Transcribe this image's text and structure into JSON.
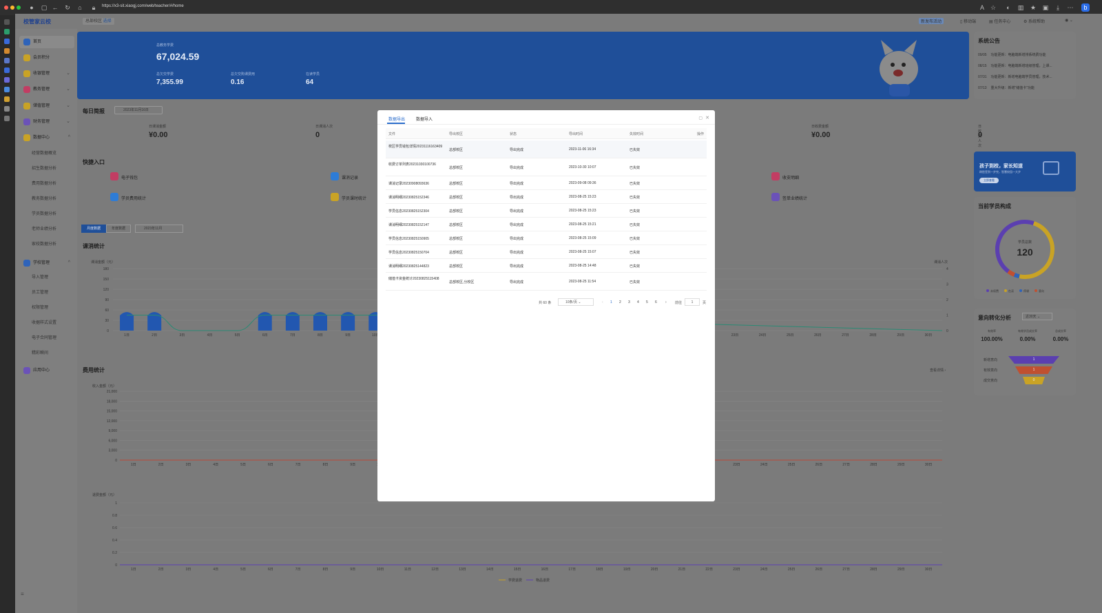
{
  "browser": {
    "url": "https://x3-sit.xiaogj.com/web/teacher/#/home"
  },
  "app": {
    "logo": "校管家云校",
    "campus": "总部校区",
    "campus_switch": "选择"
  },
  "top_right": {
    "badge": "新发布活动",
    "item1": "移动端",
    "item2": "任务中心",
    "item3": "系统帮助"
  },
  "sidebar": {
    "items": [
      {
        "label": "首页",
        "color": "#2e63b9",
        "top": 10
      },
      {
        "label": "会员积分",
        "color": "#c9a325",
        "top": 33
      },
      {
        "label": "收银管理",
        "color": "#c9a325",
        "top": 56,
        "chev": "⌄"
      },
      {
        "label": "教务管理",
        "color": "#c23d63",
        "top": 79,
        "chev": "⌄"
      },
      {
        "label": "储值管理",
        "color": "#c9a325",
        "top": 103,
        "chev": "⌄"
      },
      {
        "label": "财务管理",
        "color": "#6b52b8",
        "top": 126,
        "chev": "⌄"
      },
      {
        "label": "数据中心",
        "color": "#c9a325",
        "top": 149,
        "chev": "^"
      }
    ],
    "data_sub": [
      "经营数据概览",
      "招生数据分析",
      "费用数据分析",
      "教务数据分析",
      "学员数据分析",
      "老师业绩分析",
      "家校数据分析"
    ],
    "school": {
      "label": "学校管理",
      "chev": "^"
    },
    "school_sub": [
      "导入管理",
      "员工管理",
      "权限管理",
      "收据样式设置",
      "电子合同管理",
      "精彩瞬间"
    ],
    "app_center": "应用中心"
  },
  "hero": {
    "total_fee_label": "总教务学费",
    "total_fee": "67,024.59",
    "fee_label": "总欠交学费",
    "fee": "7,355.99",
    "avg_label": "总欠交购课费用",
    "avg": "0.16",
    "students_label": "在读学员",
    "students": "64"
  },
  "notice": {
    "title": "系统公告",
    "rows": [
      {
        "date": "09/05",
        "text": "功能更新：电脑端新增排系统费功能"
      },
      {
        "date": "08/15",
        "text": "功能更新：电脑端新增班级管理，上课..."
      },
      {
        "date": "07/31",
        "text": "功能更新：新增电脑端学员管理，技术..."
      },
      {
        "date": "07/13",
        "text": "重大升级：新增“储值卡”功能"
      }
    ]
  },
  "daily": {
    "title": "每日简报",
    "date": "2023年11月16日",
    "stats": [
      {
        "label": "日课消金额",
        "value": "¥0.00"
      },
      {
        "label": "日课消人次",
        "value": "0"
      },
      {
        "label": "日收费金额",
        "value": "¥0.00"
      },
      {
        "label": "日收费人次",
        "value": "0"
      }
    ]
  },
  "quick": {
    "title": "快捷入口",
    "items": [
      "电子钱包",
      "课消记录",
      "收支明细",
      "学员费用统计",
      "学员课时统计",
      "签单业绩统计"
    ]
  },
  "monthly": {
    "tab1": "月度数据",
    "tab2": "年度数据",
    "month": "2023年11月"
  },
  "course_chart": {
    "title": "课消统计",
    "ylabel": "课消金额（元）",
    "y2label": "课消人次",
    "y_ticks": [
      "180",
      "150",
      "120",
      "90",
      "60",
      "30",
      "0"
    ],
    "y2_ticks": [
      "4",
      "3",
      "2",
      "1",
      "0"
    ]
  },
  "fee_chart": {
    "title": "费用统计",
    "link": "查看详情 ›",
    "ylabel": "收入金额（元）",
    "y_ticks": [
      "21,000",
      "18,000",
      "15,000",
      "12,000",
      "9,000",
      "6,000",
      "3,000",
      "0"
    ]
  },
  "refund_chart": {
    "ylabel": "退费金额（元）",
    "y_ticks": [
      "1",
      "0.8",
      "0.6",
      "0.4",
      "0.2",
      "0"
    ],
    "legend1": "学费退费",
    "legend2": "物品退费"
  },
  "x_days_early": [
    "1日",
    "2日",
    "3日",
    "4日",
    "5日",
    "6日",
    "7日",
    "8日",
    "9日",
    "10日"
  ],
  "x_days_late": [
    "23日",
    "24日",
    "25日",
    "26日",
    "27日",
    "28日",
    "29日",
    "30日"
  ],
  "x_days_all": [
    "1日",
    "2日",
    "3日",
    "4日",
    "5日",
    "6日",
    "7日",
    "8日",
    "9日",
    "10日",
    "11日",
    "12日",
    "13日",
    "14日",
    "15日",
    "16日",
    "17日",
    "18日",
    "19日",
    "20日",
    "21日",
    "22日",
    "23日",
    "24日",
    "25日",
    "26日",
    "27日",
    "28日",
    "29日",
    "30日"
  ],
  "chart_data": {
    "type": "bar",
    "title": "课消统计",
    "categories": [
      "1日",
      "2日",
      "3日",
      "4日",
      "5日",
      "6日",
      "7日",
      "8日",
      "9日",
      "10日"
    ],
    "series": [
      {
        "name": "课消金额",
        "values": [
          60,
          60,
          0,
          0,
          0,
          60,
          60,
          60,
          60,
          60
        ]
      },
      {
        "name": "课消人次",
        "values": [
          1,
          1,
          0,
          0,
          0,
          1,
          1,
          1,
          1,
          1
        ]
      }
    ],
    "ylim": [
      0,
      180
    ]
  },
  "ad": {
    "title": "孩子到校，家长知道",
    "sub": "刷脸签到一步完，智慧校园一大步",
    "btn": "立即查看"
  },
  "students": {
    "title": "当前学员构成",
    "label": "学员总数",
    "total": "120",
    "legend": [
      "未续费",
      "在读",
      "停课",
      "意向"
    ]
  },
  "conversion": {
    "title": "意向转化分析",
    "range": "近30天",
    "stats": [
      {
        "label": "有效率",
        "value": "100.00%"
      },
      {
        "label": "有效学员成交率",
        "value": "0.00%"
      },
      {
        "label": "总成交率",
        "value": "0.00%"
      }
    ],
    "funnel": [
      {
        "label": "新增意向",
        "value": "1"
      },
      {
        "label": "有效意向",
        "value": "1"
      },
      {
        "label": "成交意向",
        "value": "0"
      }
    ]
  },
  "modal": {
    "tab_export": "数据导出",
    "tab_import": "数据导入",
    "headers": [
      "文件",
      "导出校区",
      "状态",
      "导出时间",
      "失效时间",
      "操作"
    ],
    "rows": [
      {
        "file": "校区学员钱包详情20231116163409",
        "campus": "总部校区",
        "status": "导出完成",
        "time": "2023-11-06 16:34",
        "expire": "已失效"
      },
      {
        "file": "收费订单列表20231030100736",
        "campus": "总部校区",
        "status": "导出完成",
        "time": "2023-10-30 10:07",
        "expire": "已失效"
      },
      {
        "file": "课消记录20230908093636",
        "campus": "总部校区",
        "status": "导出完成",
        "time": "2023-09-08 09:36",
        "expire": "已失效"
      },
      {
        "file": "课消明细20230825152346",
        "campus": "总部校区",
        "status": "导出完成",
        "time": "2023-08-25 15:23",
        "expire": "已失效"
      },
      {
        "file": "学员信息20230825152304",
        "campus": "总部校区",
        "status": "导出完成",
        "time": "2023-08-25 15:23",
        "expire": "已失效"
      },
      {
        "file": "课消明细20230825152147",
        "campus": "总部校区",
        "status": "导出完成",
        "time": "2023-08-25 15:21",
        "expire": "已失效"
      },
      {
        "file": "学员信息20230825150905",
        "campus": "总部校区",
        "status": "导出完成",
        "time": "2023-08-25 15:09",
        "expire": "已失效"
      },
      {
        "file": "学员信息20230825150704",
        "campus": "总部校区",
        "status": "导出完成",
        "time": "2023-08-25 15:07",
        "expire": "已失效"
      },
      {
        "file": "课消明细20230825144823",
        "campus": "总部校区",
        "status": "导出完成",
        "time": "2023-08-25 14:48",
        "expire": "已失效"
      },
      {
        "file": "储值卡资金统计20230825115408",
        "campus": "总部校区,分校区",
        "status": "导出完成",
        "time": "2023-08-25 11:54",
        "expire": "已失效"
      }
    ],
    "total": "共 60 条",
    "page_size": "10条/页",
    "pages": [
      "1",
      "2",
      "3",
      "4",
      "5",
      "6"
    ],
    "goto": "前往",
    "goto_val": "1",
    "page_unit": "页"
  }
}
